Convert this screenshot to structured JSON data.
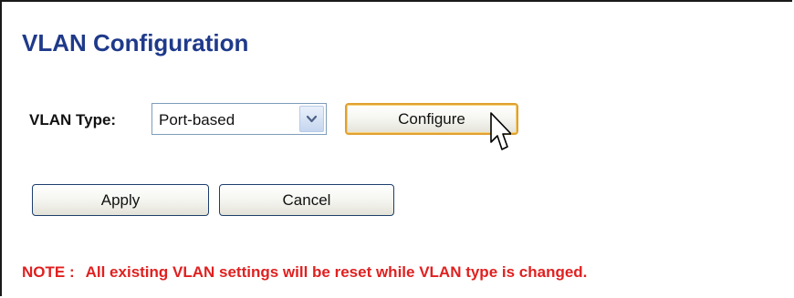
{
  "page": {
    "title": "VLAN Configuration"
  },
  "form": {
    "vlan_type_label": "VLAN Type:",
    "vlan_type_selected": "Port-based",
    "configure_label": "Configure",
    "apply_label": "Apply",
    "cancel_label": "Cancel"
  },
  "note": {
    "prefix": "NOTE :",
    "text": "All existing VLAN settings will be reset while VLAN type is changed."
  },
  "icons": {
    "select_arrow": "chevron-down-icon",
    "cursor": "hand-pointer-icon"
  },
  "colors": {
    "title": "#1f3a8a",
    "note": "#e02020",
    "button_border": "#1c3f6e",
    "focus_border": "#e0a030"
  }
}
